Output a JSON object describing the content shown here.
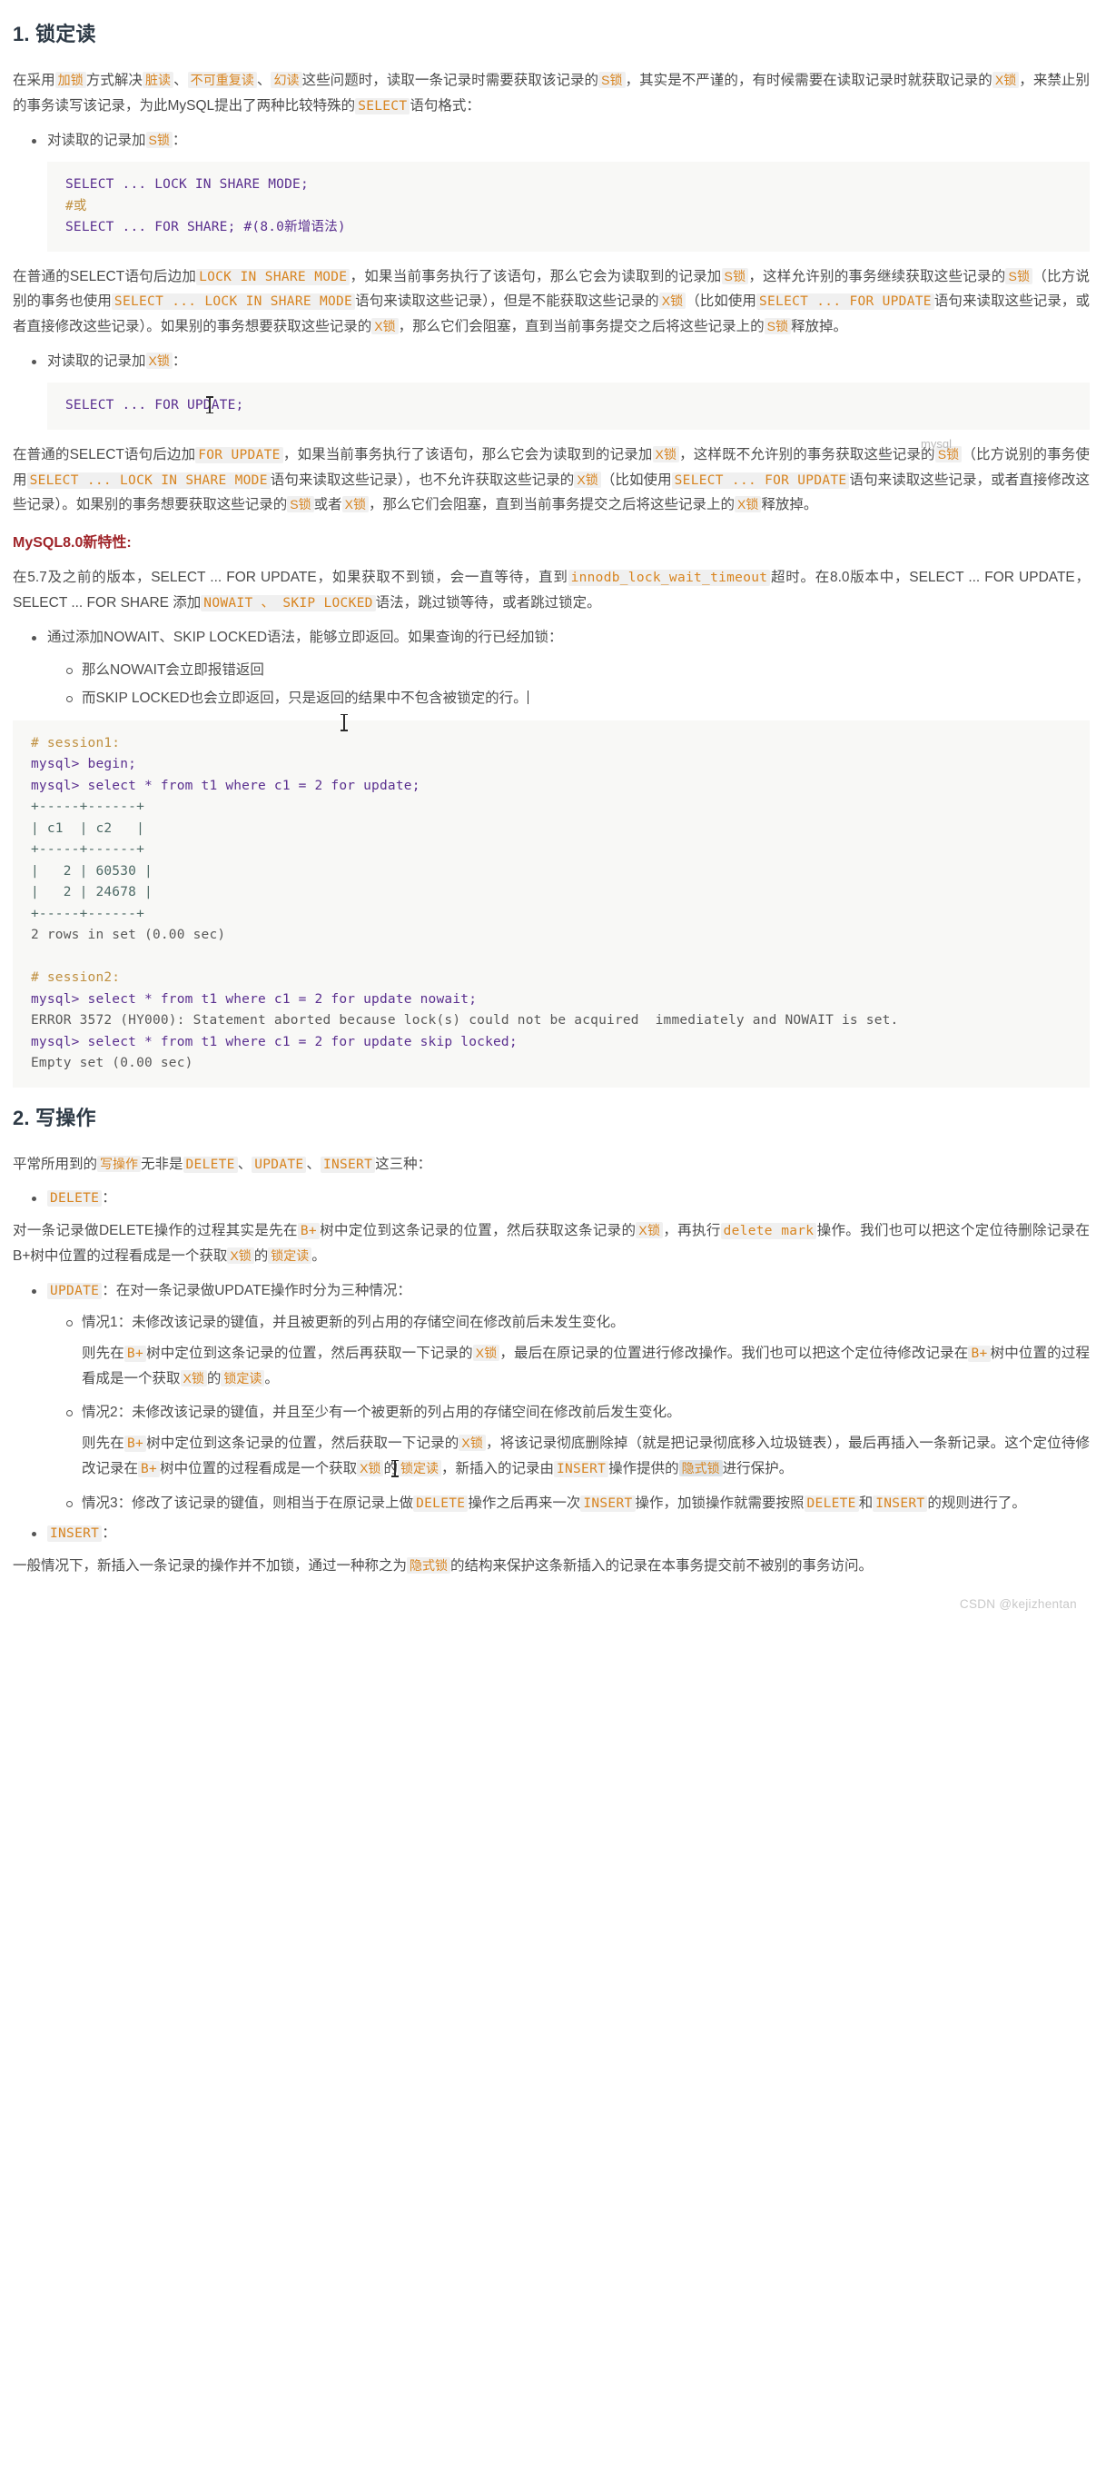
{
  "sections": {
    "s1_title": "1. 锁定读",
    "s2_title": "2. 写操作"
  },
  "intro": {
    "p1_a": "在采用",
    "p1_t1": "加锁",
    "p1_b": "方式解决",
    "p1_t2": "脏读",
    "p1_c": "、",
    "p1_t3": "不可重复读",
    "p1_d": "、",
    "p1_t4": "幻读",
    "p1_e": "这些问题时，读取一条记录时需要获取该记录的",
    "p1_t5": "S锁",
    "p1_f": "，其实是不严谨的，有时候需要在读取记录时就获取记录的",
    "p1_t6": "X锁",
    "p1_g": "，来禁止别的事务读写该记录，为此MySQL提出了两种比较特殊的",
    "p1_t7": "SELECT",
    "p1_h": "语句格式："
  },
  "bullet_s": {
    "a": "对读取的记录加",
    "t": "S锁",
    "b": "："
  },
  "code_share": "SELECT ... LOCK IN SHARE MODE;\n#或\nSELECT ... FOR SHARE; #(8.0新增语法)",
  "code_share_lines": [
    {
      "text": "SELECT ... LOCK IN SHARE MODE;",
      "cls": "kw"
    },
    {
      "text": "#或",
      "cls": "cm"
    },
    {
      "text": "SELECT ... FOR SHARE; #(8.0新增语法)",
      "cls": "kw"
    }
  ],
  "para_share": {
    "a": "在普通的SELECT语句后边加",
    "t1": "LOCK IN SHARE MODE",
    "b": "，如果当前事务执行了该语句，那么它会为读取到的记录加",
    "t2": "S锁",
    "c": "，这样允许别的事务继续获取这些记录的",
    "t3": "S锁",
    "d": "（比方说别的事务也使用",
    "t4": "SELECT ... LOCK IN SHARE MODE",
    "e": "语句来读取这些记录），但是不能获取这些记录的",
    "t5": "X锁",
    "f": "（比如使用",
    "t6": "SELECT ... FOR UPDATE",
    "g": "语句来读取这些记录，或者直接修改这些记录）。如果别的事务想要获取这些记录的",
    "t7": "X锁",
    "h": "，那么它们会阻塞，直到当前事务提交之后将这些记录上的",
    "t8": "S锁",
    "i": "释放掉。"
  },
  "bullet_x": {
    "a": "对读取的记录加",
    "t": "X锁",
    "b": "："
  },
  "code_update_lines": [
    {
      "text": "SELECT ... FOR UPDATE;",
      "cls": "kw"
    }
  ],
  "watermark_mysql": "mysql",
  "para_update": {
    "a": "在普通的SELECT语句后边加",
    "t1": "FOR UPDATE",
    "b": "，如果当前事务执行了该语句，那么它会为读取到的记录加",
    "t2": "X锁",
    "c": "，这样既不允许别的事务获取这些记录的",
    "t3": "S锁",
    "d": "（比方说别的事务使用",
    "t4": "SELECT ... LOCK IN SHARE MODE",
    "e": "语句来读取这些记录），也不允许获取这些记录的",
    "t5": "X锁",
    "f": "（比如使用",
    "t6": "SELECT ... FOR UPDATE",
    "g": "语句来读取这些记录，或者直接修改这些记录）。如果别的事务想要获取这些记录的",
    "t7": "S锁",
    "h": "或者",
    "t8": "X锁",
    "i": "，那么它们会阻塞，直到当前事务提交之后将这些记录上的",
    "t9": "X锁",
    "j": "释放掉。"
  },
  "mysql80": {
    "heading": "MySQL8.0新特性:",
    "p_a": "在5.7及之前的版本，SELECT ... FOR UPDATE，如果获取不到锁，会一直等待，直到",
    "p_t1": "innodb_lock_wait_timeout",
    "p_b": "超时。在8.0版本中，SELECT ... FOR UPDATE，SELECT ... FOR SHARE 添加",
    "p_t2": "NOWAIT 、 SKIP LOCKED",
    "p_c": "语法，跳过锁等待，或者跳过锁定。",
    "b1": "通过添加NOWAIT、SKIP LOCKED语法，能够立即返回。如果查询的行已经加锁：",
    "b1_1": "那么NOWAIT会立即报错返回",
    "b1_2": "而SKIP LOCKED也会立即返回，只是返回的结果中不包含被锁定的行。"
  },
  "terminal_lines": [
    {
      "text": "# session1:",
      "cls": "cm"
    },
    {
      "text": "mysql> begin;",
      "cls": "kw"
    },
    {
      "text": "mysql> select * from t1 where c1 = 2 for update;",
      "cls": "kw"
    },
    {
      "text": "+-----+------+",
      "cls": "tbl"
    },
    {
      "text": "| c1  | c2   |",
      "cls": "tbl"
    },
    {
      "text": "+-----+------+",
      "cls": "tbl"
    },
    {
      "text": "|   2 | 60530 |",
      "cls": "tbl"
    },
    {
      "text": "|   2 | 24678 |",
      "cls": "tbl"
    },
    {
      "text": "+-----+------+",
      "cls": "tbl"
    },
    {
      "text": "2 rows in set (0.00 sec)",
      "cls": "plain"
    },
    {
      "text": "",
      "cls": "plain"
    },
    {
      "text": "# session2:",
      "cls": "cm"
    },
    {
      "text": "mysql> select * from t1 where c1 = 2 for update nowait;",
      "cls": "kw"
    },
    {
      "text": "ERROR 3572 (HY000): Statement aborted because lock(s) could not be acquired  immediately and NOWAIT is set.",
      "cls": "plain"
    },
    {
      "text": "mysql> select * from t1 where c1 = 2 for update skip locked;",
      "cls": "kw"
    },
    {
      "text": "Empty set (0.00 sec)",
      "cls": "plain"
    }
  ],
  "write_ops": {
    "p_a": "平常所用到的",
    "p_t0": "写操作",
    "p_b": "无非是",
    "p_t1": "DELETE",
    "p_c": "、",
    "p_t2": "UPDATE",
    "p_d": "、",
    "p_t3": "INSERT",
    "p_e": "这三种：",
    "delete_label": "DELETE",
    "delete_colon": "：",
    "delete_p_a": "对一条记录做DELETE操作的过程其实是先在",
    "delete_t1": "B+",
    "delete_p_b": "树中定位到这条记录的位置，然后获取这条记录的",
    "delete_t2": "X锁",
    "delete_p_c": "，再执行",
    "delete_t3": "delete mark",
    "delete_p_d": "操作。我们也可以把这个定位待删除记录在B+树中位置的过程看成是一个获取",
    "delete_t4": "X锁",
    "delete_p_e": "的",
    "delete_t5": "锁定读",
    "delete_p_f": "。",
    "update_label": "UPDATE",
    "update_colon": "：在对一条记录做UPDATE操作时分为三种情况：",
    "case1_title": "情况1：未修改该记录的键值，并且被更新的列占用的存储空间在修改前后未发生变化。",
    "case1_a": "则先在",
    "case1_t1": "B+",
    "case1_b": "树中定位到这条记录的位置，然后再获取一下记录的",
    "case1_t2": "X锁",
    "case1_c": "，最后在原记录的位置进行修改操作。我们也可以把这个定位待修改记录在",
    "case1_t3": "B+",
    "case1_d": "树中位置的过程看成是一个获取",
    "case1_t4": "X锁",
    "case1_e": "的",
    "case1_t5": "锁定读",
    "case1_f": "。",
    "case2_title": "情况2：未修改该记录的键值，并且至少有一个被更新的列占用的存储空间在修改前后发生变化。",
    "case2_a": "则先在",
    "case2_t1": "B+",
    "case2_b": "树中定位到这条记录的位置，然后获取一下记录的",
    "case2_t2": "X锁",
    "case2_c": "，将该记录彻底删除掉（就是把记录彻底移入垃圾链表），最后再插入一条新记录。这个定位待修改记录在",
    "case2_t3": "B+",
    "case2_d": "树中位置的过程看成是一个获取",
    "case2_t4": "X锁",
    "case2_e": "的",
    "case2_t5": "锁定读",
    "case2_f": "，新插入的记录由",
    "case2_t6": "INSERT",
    "case2_g": "操作提供的",
    "case2_t7": "隐式锁",
    "case2_h": "进行保护。",
    "case3_a": "情况3：修改了该记录的键值，则相当于在原记录上做",
    "case3_t1": "DELETE",
    "case3_b": "操作之后再来一次",
    "case3_t2": "INSERT",
    "case3_c": "操作，加锁操作就需要按照",
    "case3_t3": "DELETE",
    "case3_d": "和",
    "case3_t4": "INSERT",
    "case3_e": "的规则进行了。",
    "insert_label": "INSERT",
    "insert_colon": "：",
    "insert_p_a": "一般情况下，新插入一条记录的操作并不加锁，通过一种称之为",
    "insert_t1": "隐式锁",
    "insert_p_b": "的结构来保护这条新插入的记录在本事务提交前不被别的事务访问。"
  },
  "footer": {
    "watermark": "CSDN @kejizhentan"
  },
  "colors": {
    "token": "#d8841f",
    "token_bg": "#f0f0f0",
    "heading": "#2f3b47",
    "red_heading": "#a0252a",
    "code_kw": "#5a2f8f",
    "code_comment": "#bf8f3f",
    "code_table": "#4d6a66",
    "code_bg": "#f8f8f6",
    "body": "#4b4b4b"
  }
}
